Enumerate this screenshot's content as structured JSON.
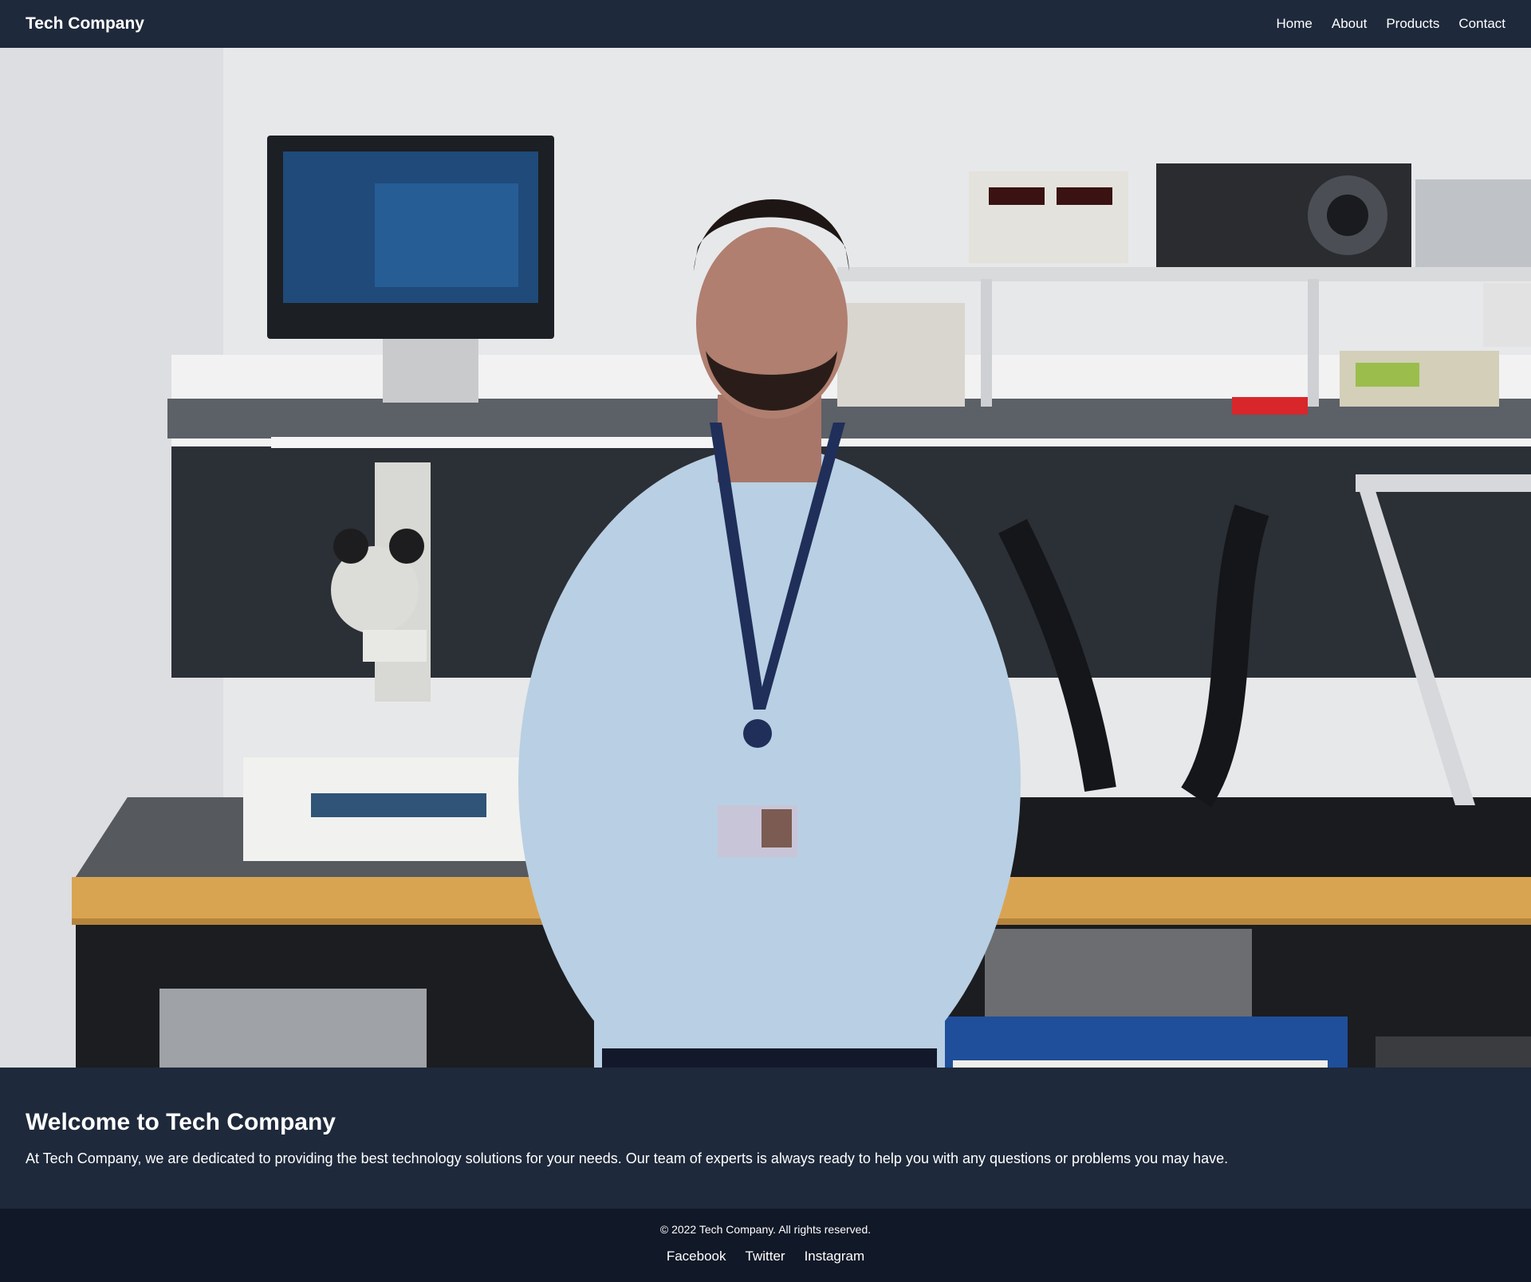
{
  "header": {
    "brand": "Tech Company",
    "nav": [
      {
        "label": "Home"
      },
      {
        "label": "About"
      },
      {
        "label": "Products"
      },
      {
        "label": "Contact"
      }
    ]
  },
  "hero": {
    "image_description_icon": "photo"
  },
  "intro": {
    "title": "Welcome to Tech Company",
    "text": "At Tech Company, we are dedicated to providing the best technology solutions for your needs. Our team of experts is always ready to help you with any questions or problems you may have."
  },
  "footer": {
    "copyright": "© 2022 Tech Company. All rights reserved.",
    "social": [
      {
        "label": "Facebook"
      },
      {
        "label": "Twitter"
      },
      {
        "label": "Instagram"
      }
    ]
  },
  "colors": {
    "header_bg": "#1e293b",
    "footer_bg": "#111827",
    "text": "#ffffff"
  }
}
